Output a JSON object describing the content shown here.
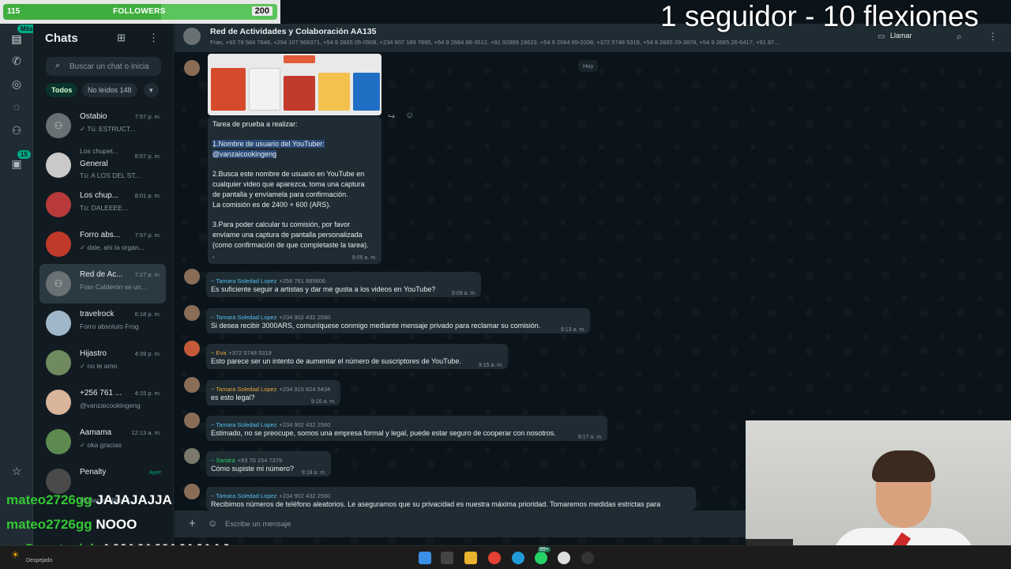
{
  "stream_overlay": {
    "goal_left": "115",
    "goal_label": "FOLLOWERS",
    "goal_right": "200",
    "goal_progress": 0.575,
    "headline": "1 seguidor - 10 flexiones",
    "chat_messages": [
      {
        "user": "mateo2726gg",
        "text": "JAJAJAJJA"
      },
      {
        "user": "mateo2726gg",
        "text": "NOOO"
      },
      {
        "user": "Danutovich",
        "text": "AJJAJAJJAJAJAAJ"
      }
    ]
  },
  "rail": {
    "mas_badge": "Más",
    "status_badge": "15"
  },
  "chats_panel": {
    "title": "Chats",
    "search_placeholder": "Buscar un chat o inicia",
    "filters": {
      "all": "Todos",
      "unread": "No leídos 148"
    },
    "items": [
      {
        "name": "Ostabio",
        "time": "7:57 p. m.",
        "preview": "✓ Tú: ESTRUCT..."
      },
      {
        "name": "General",
        "time": "8:57 p. m.",
        "preview": "Tú: A LOS DEL ST...",
        "community": "Los chupet..."
      },
      {
        "name": "Los chup...",
        "time": "8:01 p. m.",
        "preview": "Tú: DALEEEE..."
      },
      {
        "name": "Forro abs...",
        "time": "7:57 p. m.",
        "preview": "✓ dale, ahi la organ..."
      },
      {
        "name": "Red de Ac...",
        "time": "7:27 p. m.",
        "preview": "Fran Calderón se un..."
      },
      {
        "name": "travelrock",
        "time": "6:18 p. m.",
        "preview": "Forro absoluto Frog"
      },
      {
        "name": "Hijastro",
        "time": "4:39 p. m.",
        "preview": "✓ no te amo"
      },
      {
        "name": "+256 761 ...",
        "time": "4:15 p. m.",
        "preview": "@vanzaicookingeng"
      },
      {
        "name": "Aamama",
        "time": "12:13 a. m.",
        "preview": "✓ oka gracias"
      },
      {
        "name": "Penalty",
        "time": "Ayer",
        "preview": "Muñecito Riko: J..."
      }
    ]
  },
  "conversation": {
    "title": "Red de Actividades y Colaboración AA135",
    "members": "Fran, +93 78 584 7646, +254 107 566371, +54 9 2665 05-0508, +234 907 189 7895, +54 9 2664 88-3512, +91 92869 19623, +54 9 2664 89-0206, +372 5748 5319, +54 9 2665 29-3878, +54 9 2665 26-6417, +91 87...",
    "call_label": "Llamar",
    "date_separator": "Hoy",
    "task_message": {
      "lines": [
        "Tarea de prueba a realizar:",
        "",
        "1.Nombre de usuario del YouTuber:",
        "@vanzaicookingeng",
        "",
        "2.Busca este nombre de usuario en YouTube en",
        "cualquier video que aparezca, toma una captura",
        "de pantalla y envíamela para confirmación.",
        "La comisión es de 2400 + 600 (ARS).",
        "",
        "3.Para poder calcular tu comisión, por favor",
        "envíame una captura de pantalla personalizada",
        "(como confirmación de que completaste la tarea).",
        "."
      ],
      "time": "9:05 a. m."
    },
    "messages": [
      {
        "sender": "~ Tamara Soledad Lopez",
        "phone": "+256 761 889806",
        "text": "Es suficiente seguir a artistas y dar me gusta a los videos en YouTube?",
        "time": "9:09 a. m.",
        "color": "#53bdeb"
      },
      {
        "sender": "~ Tamara Soledad Lopez",
        "phone": "+234 902 432 2560",
        "text": "Si desea recibir 3000ARS, comuníquese conmigo mediante mensaje privado para reclamar su comisión.",
        "time": "9:13 a. m.",
        "color": "#53bdeb"
      },
      {
        "sender": "~ Eva",
        "phone": "+372 5748 5319",
        "text": "Esto parece ser un intento de aumentar el número de suscriptores de YouTube.",
        "time": "9:15 a. m.",
        "color": "#e5a43b"
      },
      {
        "sender": "~ Tamara Soledad Lopez",
        "phone": "+234 915 824 5434",
        "text": "es esto legal?",
        "time": "9:16 a. m.",
        "color": "#e5a43b"
      },
      {
        "sender": "~ Tamara Soledad Lopez",
        "phone": "+234 902 432 2560",
        "text": "Estimado, no se preocupe, somos una empresa formal y legal, puede estar seguro de cooperar con nosotros.",
        "time": "9:17 a. m.",
        "color": "#53bdeb"
      },
      {
        "sender": "~ Sandra",
        "phone": "+93 70 154 7379",
        "text": "Cómo supiste mi número?",
        "time": "9:18 a. m.",
        "color": "#25d366"
      },
      {
        "sender": "~ Tamara Soledad Lopez",
        "phone": "+234 902 432 2560",
        "text": "Recibimos números de teléfono aleatorios. Le aseguramos que su privacidad es nuestra máxima prioridad. Tomaremos medidas estrictas para",
        "time": "",
        "color": "#53bdeb"
      }
    ],
    "composer_placeholder": "Escribe un mensaje"
  },
  "taskbar": {
    "weather": "Despejado",
    "tray_badge": "99+"
  }
}
